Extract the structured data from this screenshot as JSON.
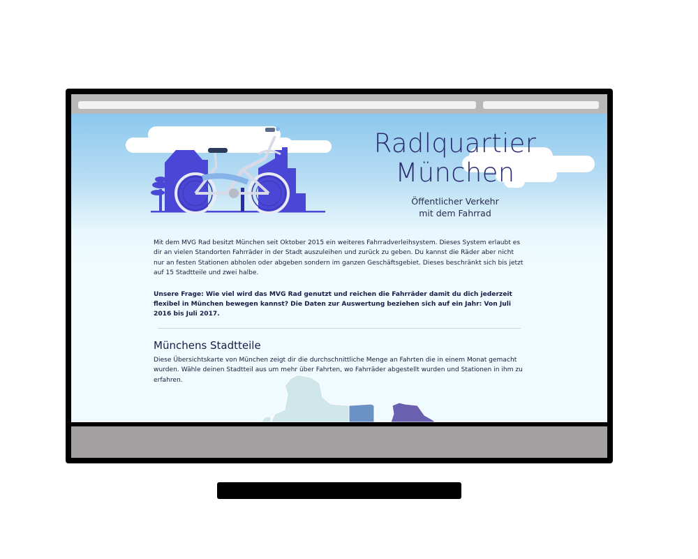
{
  "hero": {
    "title_line1": "Radlquartier",
    "title_line2": "München",
    "subtitle_line1": "Öffentlicher Verkehr",
    "subtitle_line2": "mit dem Fahrrad"
  },
  "intro": "Mit dem MVG Rad besitzt München seit Oktober 2015 ein weiteres Fahrradverleihsystem. Dieses System erlaubt es dir an vielen Standorten Fahrräder in der Stadt auszuleihen und zurück zu geben. Du kannst die Räder aber nicht nur an festen Stationen abholen oder abgeben sondern im ganzen Geschäftsgebiet. Dieses beschränkt sich bis jetzt auf 15 Stadtteile und zwei halbe.",
  "question": "Unsere Frage: Wie viel wird das MVG Rad genutzt und reichen die Fahrräder damit du dich jederzeit flexibel in München bewegen kannst? Die Daten zur Auswertung beziehen sich auf ein Jahr: Von Juli 2016 bis Juli 2017.",
  "section": {
    "title": "Münchens Stadtteile",
    "text": "Diese Übersichtskarte von München zeigt dir die durchschnittliche Menge an Fahrten die in einem Monat gemacht wurden. Wähle deinen Stadtteil aus um mehr über Fahrten, wo Fahrräder abgestellt wurden und Stationen in ihm zu erfahren."
  },
  "colors": {
    "title": "#2a2a6e",
    "bike_blue": "#4a46d6",
    "district_light": "#cfe6ea",
    "district_blue": "#6a92c4",
    "district_purple": "#6a60b0"
  },
  "icons": [
    "bicycle-illustration",
    "cloud-icon",
    "city-silhouette",
    "tree-icon"
  ]
}
